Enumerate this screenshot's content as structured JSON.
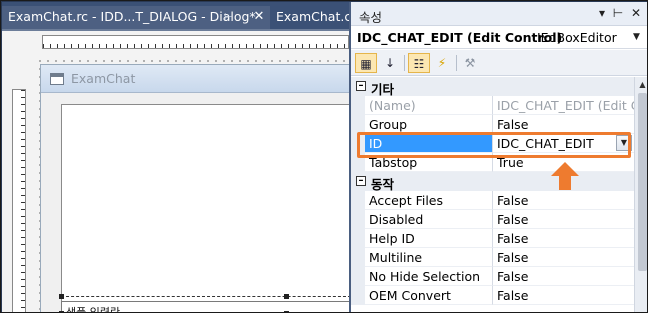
{
  "document_tabs": [
    {
      "label": "ExamChat.rc - IDD...T_DIALOG - Dialog*",
      "active": true
    },
    {
      "label": "ExamChat.cp",
      "active": false
    }
  ],
  "dialog": {
    "title": "ExamChat",
    "chat_edit_text": "샘플 입력란"
  },
  "properties": {
    "panel_title": "속성",
    "object_name": "IDC_CHAT_EDIT (Edit Control)",
    "object_type": "IEdBoxEditor",
    "categories": [
      {
        "label": "기타",
        "rows": [
          {
            "name": "(Name)",
            "value": "IDC_CHAT_EDIT (Edit Co",
            "grey": true
          },
          {
            "name": "Group",
            "value": "False"
          },
          {
            "name": "ID",
            "value": "IDC_CHAT_EDIT",
            "selected": true
          },
          {
            "name": "Tabstop",
            "value": "True"
          }
        ]
      },
      {
        "label": "동작",
        "rows": [
          {
            "name": "Accept Files",
            "value": "False"
          },
          {
            "name": "Disabled",
            "value": "False"
          },
          {
            "name": "Help ID",
            "value": "False"
          },
          {
            "name": "Multiline",
            "value": "False"
          },
          {
            "name": "No Hide Selection",
            "value": "False"
          },
          {
            "name": "OEM Convert",
            "value": "False"
          }
        ]
      }
    ]
  },
  "colors": {
    "highlight": "#ee7b2f",
    "selection": "#3399ff",
    "chrome_dark": "#293955"
  },
  "icons": [
    "pin-icon",
    "close-icon",
    "dropdown-arrow-icon",
    "categorized-icon",
    "alphabetical-icon",
    "properties-icon",
    "events-icon",
    "wrench-icon",
    "arrow-up-icon"
  ]
}
